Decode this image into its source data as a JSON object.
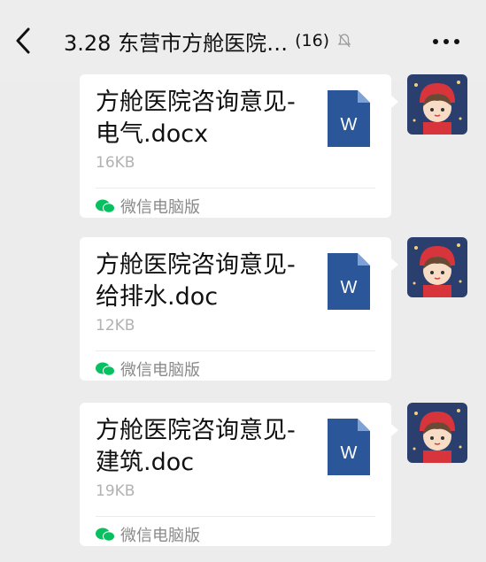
{
  "header": {
    "title": "3.28 东营市方舱医院…",
    "member_count": "(16)",
    "back_icon": "chevron-left-icon",
    "mute_icon": "bell-off-icon",
    "more_icon": "more-dots-icon"
  },
  "messages": [
    {
      "file_name": "方舱医院咨询意见-电气.docx",
      "file_size": "16KB",
      "doc_badge": "W",
      "source": "微信电脑版"
    },
    {
      "file_name": "方舱医院咨询意见-给排水.doc",
      "file_size": "12KB",
      "doc_badge": "W",
      "source": "微信电脑版"
    },
    {
      "file_name": "方舱医院咨询意见-建筑.doc",
      "file_size": "19KB",
      "doc_badge": "W",
      "source": "微信电脑版"
    }
  ],
  "colors": {
    "background": "#ececec",
    "bubble": "#ffffff",
    "word_blue": "#2b579a",
    "wechat_green": "#07c160"
  }
}
